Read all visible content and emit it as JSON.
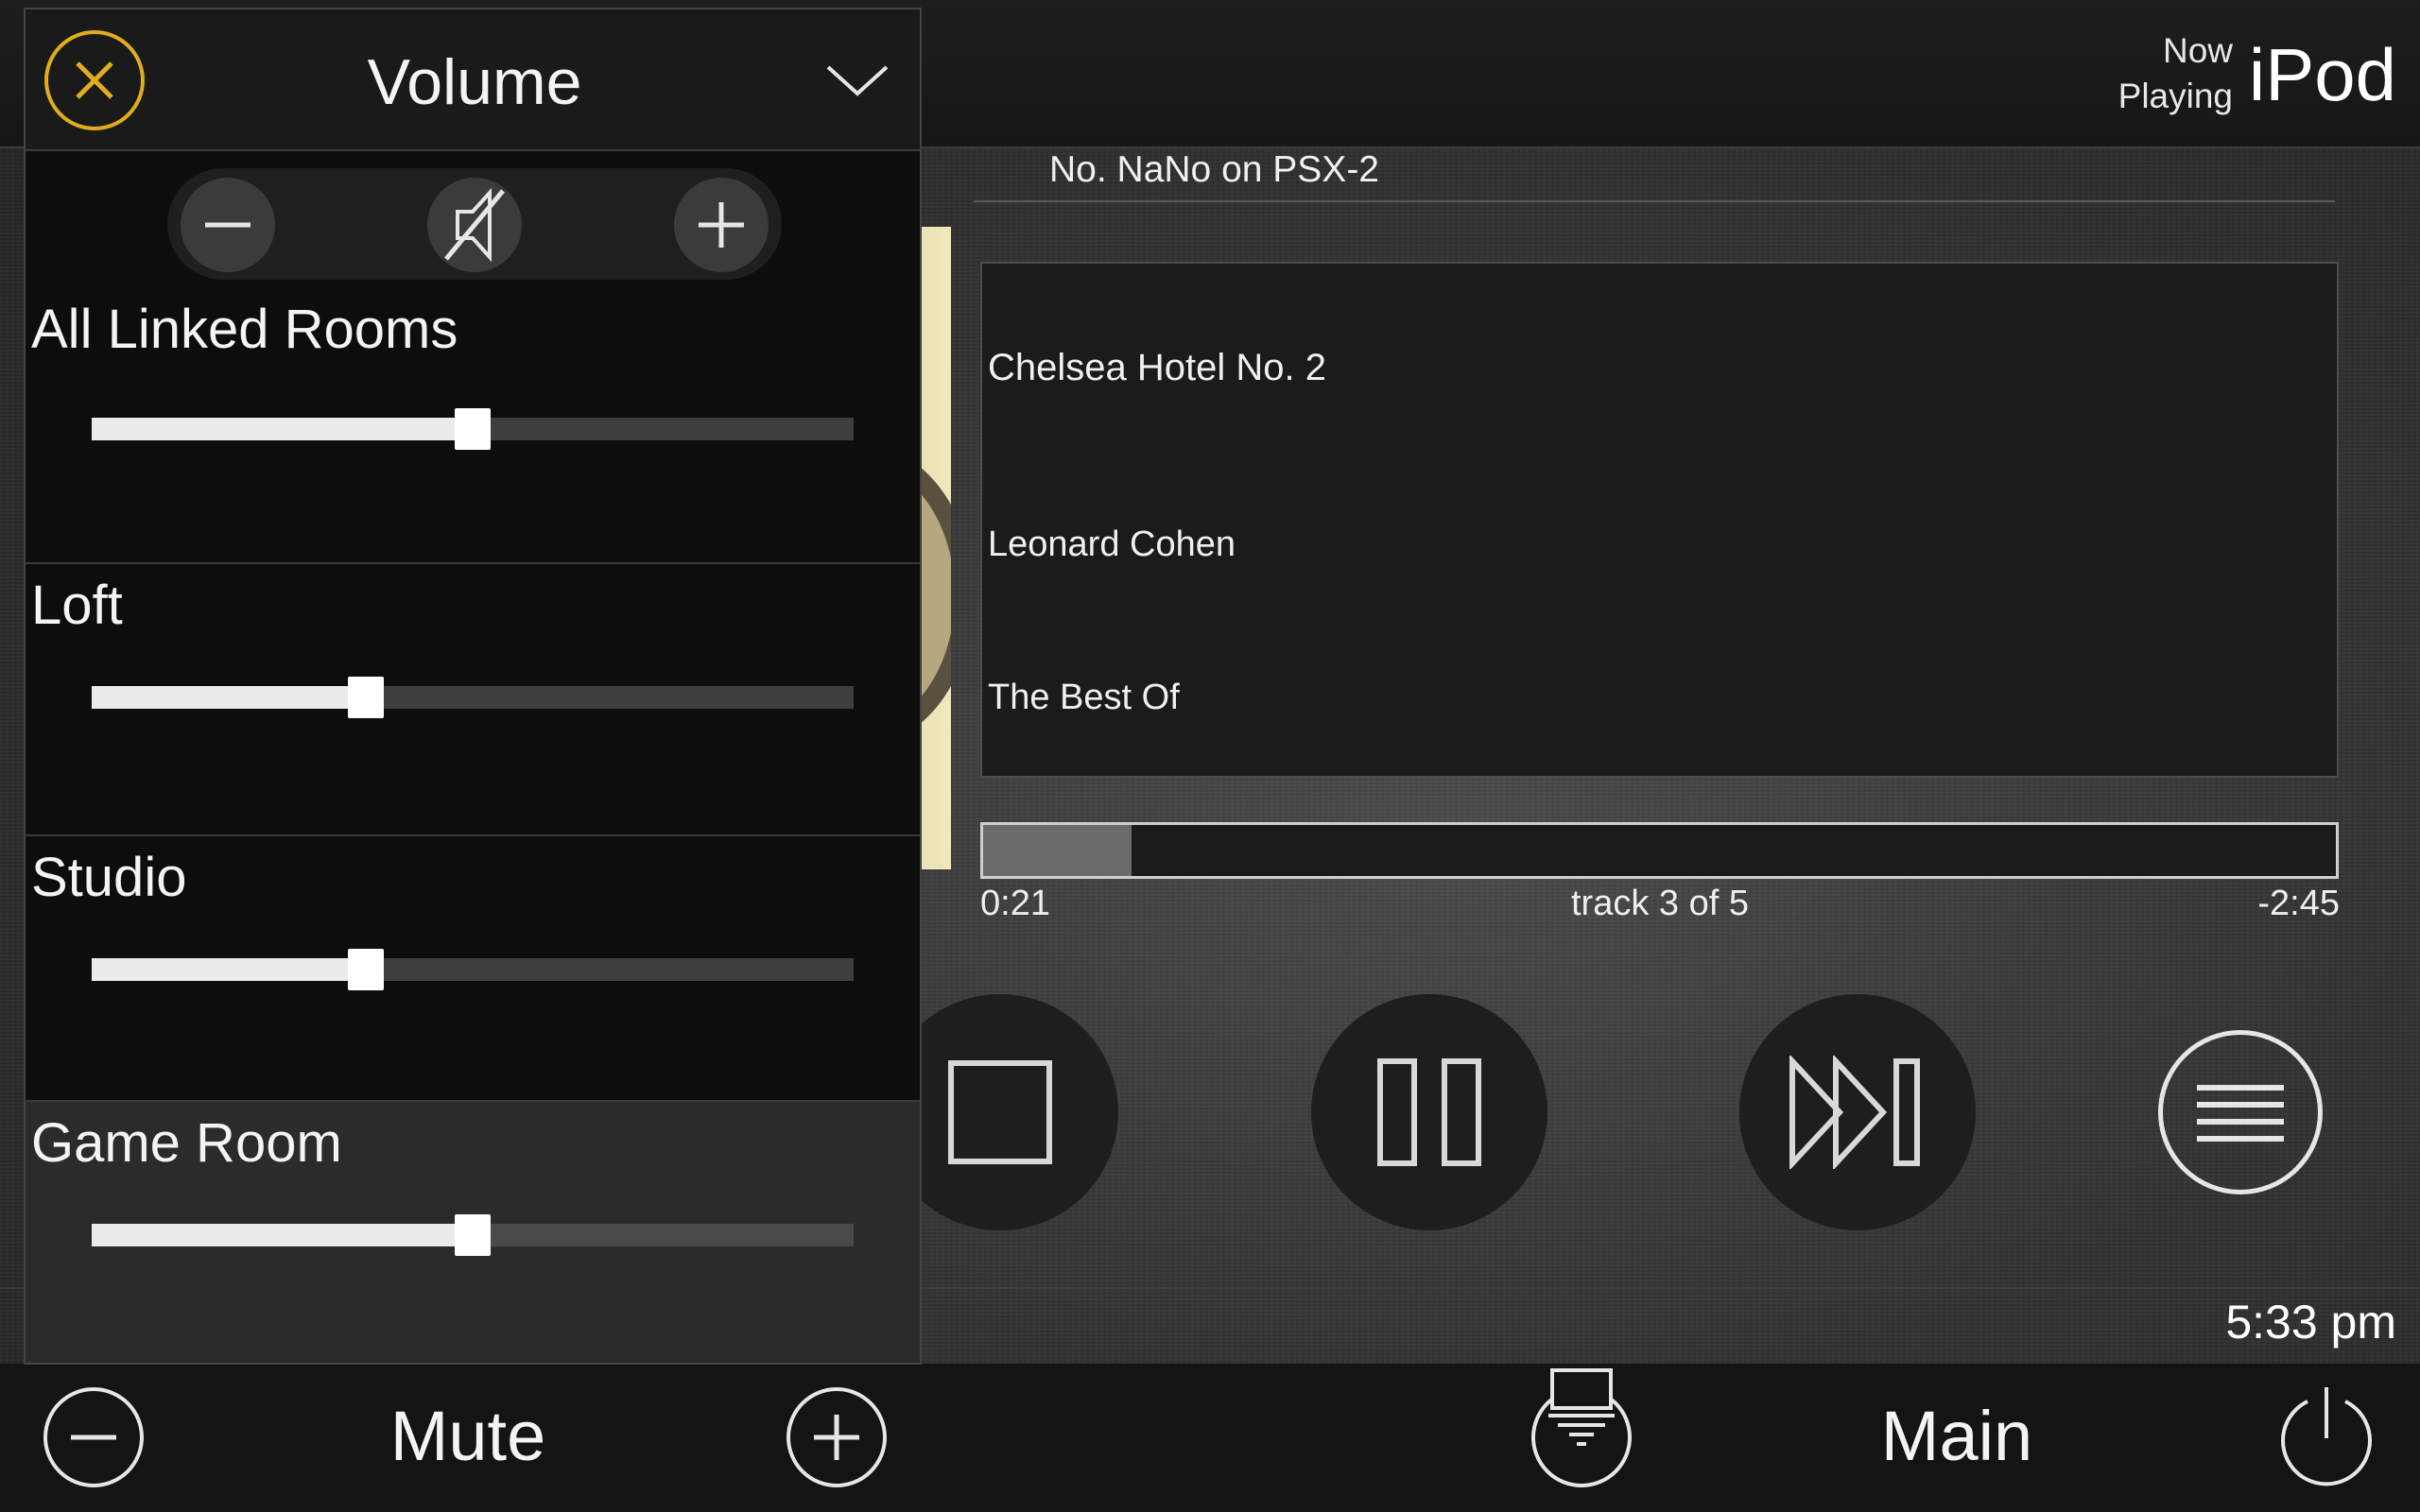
{
  "header": {
    "now_playing_label": "Now Playing",
    "source_name": "iPod"
  },
  "now_playing": {
    "zone_title": "No. NaNo on PSX-2",
    "song": "Chelsea Hotel No. 2",
    "artist": "Leonard Cohen",
    "album": "The Best Of",
    "elapsed": "0:21",
    "track_info": "track 3 of 5",
    "remaining": "-2:45",
    "progress_fraction": 0.11
  },
  "transport": {
    "icons": [
      "stop-icon",
      "pause-icon",
      "skip-next-icon",
      "menu-icon"
    ]
  },
  "status": {
    "clock": "5:33 pm"
  },
  "bottom_bar": {
    "mute_label": "Mute",
    "room_label": "Main",
    "icons": [
      "minus-icon",
      "plus-icon",
      "source-display-icon",
      "power-icon"
    ]
  },
  "volume_panel": {
    "title": "Volume",
    "accent_color": "#e0ad1c",
    "zones": [
      {
        "name": "All Linked Rooms",
        "level": 0.5,
        "selected": false
      },
      {
        "name": "Loft",
        "level": 0.36,
        "selected": false
      },
      {
        "name": "Studio",
        "level": 0.36,
        "selected": false
      },
      {
        "name": "Game Room",
        "level": 0.5,
        "selected": true
      }
    ]
  }
}
